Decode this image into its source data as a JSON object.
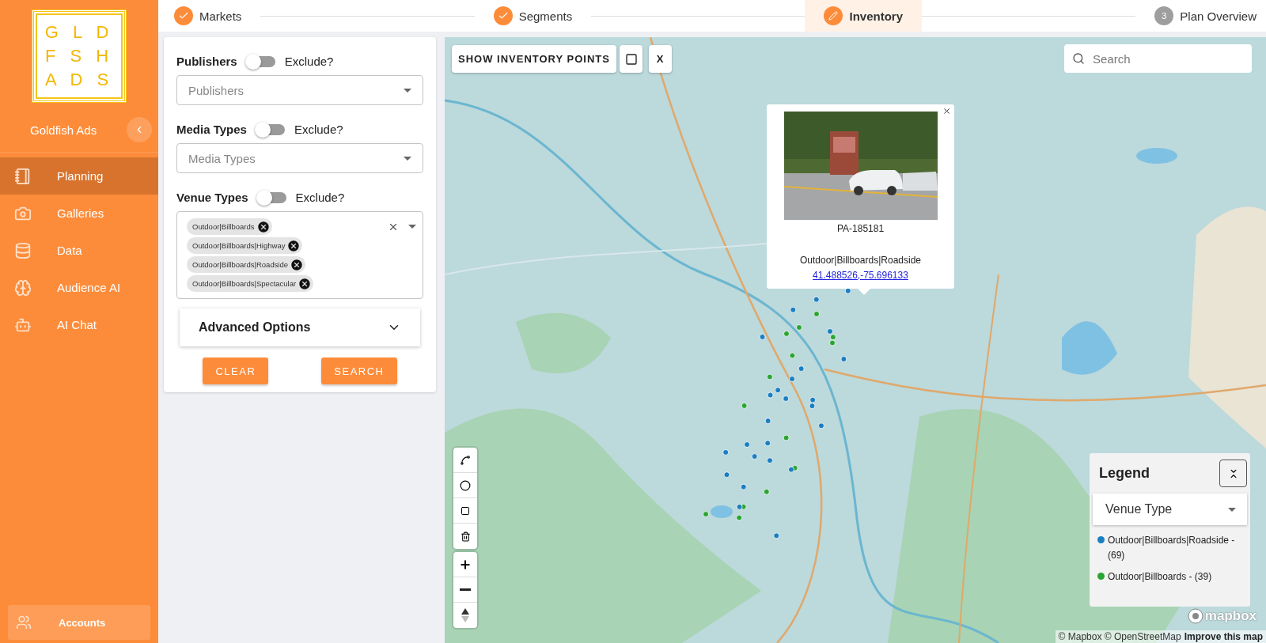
{
  "sidebar": {
    "logo_rows": [
      "G L D",
      "F S H",
      "A D S"
    ],
    "brand": "Goldfish Ads",
    "items": [
      {
        "label": "Planning",
        "selected": true
      },
      {
        "label": "Galleries",
        "selected": false
      },
      {
        "label": "Data",
        "selected": false
      },
      {
        "label": "Audience AI",
        "selected": false
      },
      {
        "label": "AI Chat",
        "selected": false
      }
    ],
    "footer_item": {
      "label": "Accounts"
    }
  },
  "stepper": [
    {
      "label": "Markets",
      "kind": "done",
      "selected": false
    },
    {
      "label": "Segments",
      "kind": "done",
      "selected": false
    },
    {
      "label": "Inventory",
      "kind": "current",
      "selected": true
    },
    {
      "label": "Plan Overview",
      "kind": "pending",
      "number": "3",
      "selected": false
    }
  ],
  "filters": {
    "groups": [
      {
        "label": "Publishers",
        "toggle_label": "Exclude?",
        "on": false,
        "placeholder": "Publishers"
      },
      {
        "label": "Media Types",
        "toggle_label": "Exclude?",
        "on": false,
        "placeholder": "Media Types"
      },
      {
        "label": "Venue Types",
        "toggle_label": "Exclude?",
        "on": false,
        "chips": [
          "Outdoor|Billboards",
          "Outdoor|Billboards|Highway",
          "Outdoor|Billboards|Roadside",
          "Outdoor|Billboards|Spectacular"
        ]
      }
    ],
    "advanced": {
      "label": "Advanced Options",
      "expanded": false
    },
    "buttons": [
      "CLEAR",
      "SEARCH"
    ]
  },
  "map": {
    "toolbar": {
      "show_points": "SHOW INVENTORY POINTS",
      "close": "X"
    },
    "search": {
      "placeholder": "Search"
    },
    "popup": {
      "id": "PA-185181",
      "venue": "Outdoor|Billboards|Roadside",
      "coords": "41.488526,-75.696133"
    },
    "legend": {
      "title": "Venue Type",
      "heading": "Legend",
      "items": [
        {
          "label": "Outdoor|Billboards|Roadside - (69)",
          "color": "#1a7fc1"
        },
        {
          "label": "Outdoor|Billboards - (39)",
          "color": "#2aa534"
        }
      ]
    },
    "logo": "mapbox",
    "attribution": "© Mapbox © OpenStreetMap",
    "improve": "Improve this map"
  }
}
